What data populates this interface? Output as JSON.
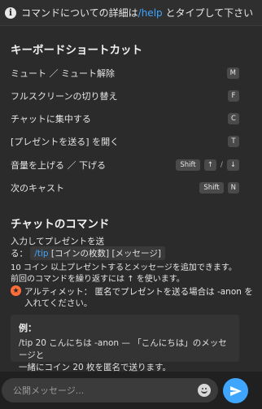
{
  "header": {
    "info_prefix": "コマンドについての詳細は",
    "info_link": "/help",
    "info_suffix": " とタイプして下さい"
  },
  "shortcuts": {
    "title": "キーボードショートカット",
    "items": [
      {
        "label": "ミュート ／ ミュート解除",
        "keys": [
          "M"
        ]
      },
      {
        "label": "フルスクリーンの切り替え",
        "keys": [
          "F"
        ]
      },
      {
        "label": "チャットに集中する",
        "keys": [
          "C"
        ]
      },
      {
        "label": "[プレゼントを送る] を開く",
        "keys": [
          "T"
        ]
      },
      {
        "label": "音量を上げる ／ 下げる",
        "keys": [
          "Shift",
          "↑",
          "/",
          "↓"
        ]
      },
      {
        "label": "次のキャスト",
        "keys": [
          "Shift",
          "N"
        ]
      }
    ]
  },
  "chat_commands": {
    "title": "チャットのコマンド",
    "line1": "入力してプレゼントを送",
    "line2_prefix": "る：",
    "code_cmd": "/tip",
    "code_rest": " [コインの枚数] [メッセージ]",
    "line3": "10 コイン 以上プレゼントするとメッセージを追加できます。",
    "line4_prefix": "前回のコマンドを繰り返すには",
    "line4_arrow": "↑",
    "line4_suffix": "を使います。",
    "ultimate_line1": "アルティメット： 匿名でプレゼントを送る場合は -anon を",
    "ultimate_line2": "入れてください。"
  },
  "example": {
    "title": "例：",
    "line1": "/tip 20 こんにちは -anon — 「こんにちは」のメッセージと",
    "line2": "一緒にコイン 20 枚を匿名で送ります。"
  },
  "composer": {
    "placeholder": "公開メッセージ..."
  },
  "colors": {
    "accent": "#3ea6ff",
    "ultimate": "#ff6d3b",
    "background": "#2b2b2b"
  }
}
